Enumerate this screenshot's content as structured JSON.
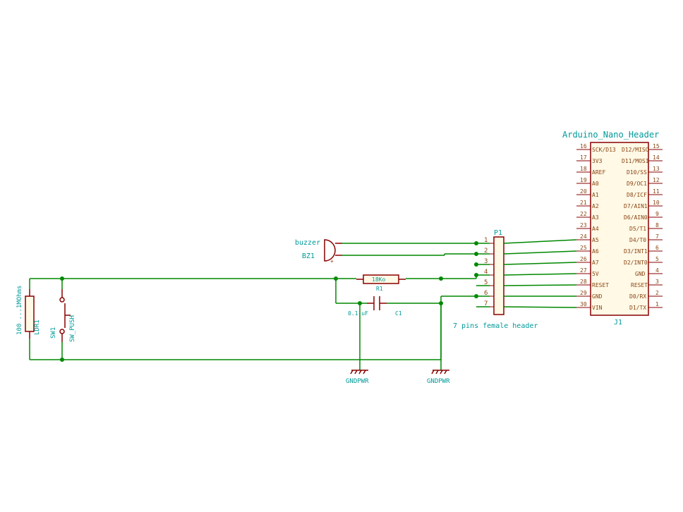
{
  "title": "Arduino_Nano_Header",
  "components": {
    "ldr": {
      "ref": "LDR1",
      "value": "100 ...1MOhms"
    },
    "sw": {
      "ref": "SW1",
      "value": "SW_PUSH"
    },
    "buzzer": {
      "ref": "BZ1",
      "label": "buzzer"
    },
    "resistor": {
      "ref": "R1",
      "value": "18Ko"
    },
    "capacitor": {
      "ref": "C1",
      "value": "0.1 uF"
    },
    "connector": {
      "ref": "P1",
      "label": "7 pins female header",
      "pins": [
        "1",
        "2",
        "3",
        "4",
        "5",
        "6",
        "7"
      ]
    },
    "arduino": {
      "ref": "J1",
      "left_pins": [
        {
          "num": "16",
          "name": "SCK/D13"
        },
        {
          "num": "17",
          "name": "3V3"
        },
        {
          "num": "18",
          "name": "AREF"
        },
        {
          "num": "19",
          "name": "A0"
        },
        {
          "num": "20",
          "name": "A1"
        },
        {
          "num": "21",
          "name": "A2"
        },
        {
          "num": "22",
          "name": "A3"
        },
        {
          "num": "23",
          "name": "A4"
        },
        {
          "num": "24",
          "name": "A5"
        },
        {
          "num": "25",
          "name": "A6"
        },
        {
          "num": "26",
          "name": "A7"
        },
        {
          "num": "27",
          "name": "5V"
        },
        {
          "num": "28",
          "name": "RESET"
        },
        {
          "num": "29",
          "name": "GND"
        },
        {
          "num": "30",
          "name": "VIN"
        }
      ],
      "right_pins": [
        {
          "num": "15",
          "name": "D12/MISO"
        },
        {
          "num": "14",
          "name": "D11/MOSI"
        },
        {
          "num": "13",
          "name": "D10/SS"
        },
        {
          "num": "12",
          "name": "D9/OC1"
        },
        {
          "num": "11",
          "name": "D8/ICF"
        },
        {
          "num": "10",
          "name": "D7/AIN1"
        },
        {
          "num": "9",
          "name": "D6/AIN0"
        },
        {
          "num": "8",
          "name": "D5/T1"
        },
        {
          "num": "7",
          "name": "D4/T0"
        },
        {
          "num": "6",
          "name": "D3/INT1"
        },
        {
          "num": "5",
          "name": "D2/INT0"
        },
        {
          "num": "4",
          "name": "GND"
        },
        {
          "num": "3",
          "name": "RESET"
        },
        {
          "num": "2",
          "name": "D0/RX"
        },
        {
          "num": "1",
          "name": "D1/TX"
        }
      ]
    },
    "gnd1": "GNDPWR",
    "gnd2": "GNDPWR"
  }
}
